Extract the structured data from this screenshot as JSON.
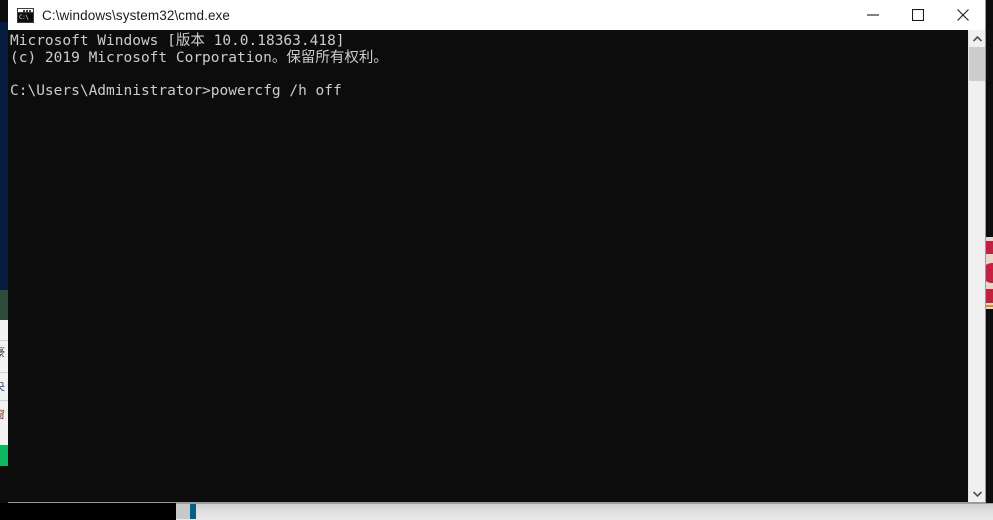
{
  "window": {
    "title": "C:\\windows\\system32\\cmd.exe",
    "icon": "cmd-icon",
    "icon_glyph": "C:\\",
    "controls": {
      "minimize_label": "Minimize",
      "maximize_label": "Maximize",
      "close_label": "Close"
    }
  },
  "console": {
    "lines": [
      "Microsoft Windows [版本 10.0.18363.418]",
      "(c) 2019 Microsoft Corporation。保留所有权利。",
      "",
      "C:\\Users\\Administrator>powercfg /h off"
    ],
    "text": "Microsoft Windows [版本 10.0.18363.418]\n(c) 2019 Microsoft Corporation。保留所有权利。\n\nC:\\Users\\Administrator>powercfg /h off",
    "os_name": "Microsoft Windows",
    "version_label": "版本",
    "version_number": "10.0.18363.418",
    "copyright": "(c) 2019 Microsoft Corporation。保留所有权利。",
    "prompt": "C:\\Users\\Administrator>",
    "command": "powercfg /h off",
    "background_color": "#0c0c0c",
    "text_color": "#cccccc"
  },
  "scrollbars": {
    "vertical": {
      "up_arrow": "▲",
      "down_arrow": "▼",
      "thumb_position": "top"
    },
    "horizontal": {
      "accent_color": "#00628b"
    }
  },
  "background": {
    "desktop_color": "#0d0d0d",
    "left_navy_color": "#071d3f",
    "left_green_color": "#2d4c3c",
    "left_accent_color": "#0fb760",
    "right_red_color": "#c2213f",
    "left_panel_glyphs": [
      "豪",
      "央",
      "窗"
    ]
  }
}
